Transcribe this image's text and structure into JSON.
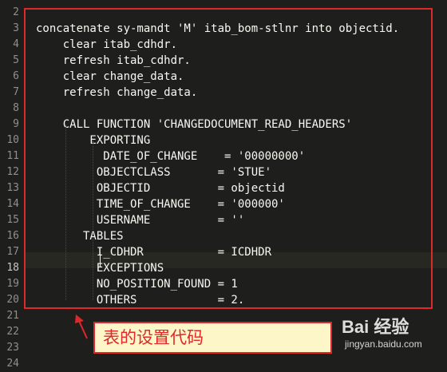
{
  "editor": {
    "line_numbers": [
      "2",
      "3",
      "4",
      "5",
      "6",
      "7",
      "8",
      "9",
      "10",
      "11",
      "12",
      "13",
      "14",
      "15",
      "16",
      "17",
      "18",
      "19",
      "20",
      "21",
      "22",
      "23",
      "24"
    ],
    "current_line": "18",
    "lines": [
      "",
      "concatenate sy-mandt 'M' itab_bom-stlnr into objectid.",
      "    clear itab_cdhdr.",
      "    refresh itab_cdhdr.",
      "    clear change_data.",
      "    refresh change_data.",
      "",
      "    CALL FUNCTION 'CHANGEDOCUMENT_READ_HEADERS'",
      "        EXPORTING",
      "          DATE_OF_CHANGE    = '00000000'",
      "         OBJECTCLASS       = 'STUE'",
      "         OBJECTID          = objectid",
      "         TIME_OF_CHANGE    = '000000'",
      "         USERNAME          = ''",
      "       TABLES",
      "         I_CDHDR           = ICDHDR",
      "         EXCEPTIONS",
      "         NO_POSITION_FOUND = 1",
      "         OTHERS            = 2.",
      "",
      "",
      "",
      ""
    ]
  },
  "annotation": {
    "label": "表的设置代码"
  },
  "watermark": {
    "logo": "Bai 经验",
    "url": "jingyan.baidu.com"
  },
  "colors": {
    "background": "#1e1f1c",
    "text": "#f8f8f2",
    "annotation_border": "#e0282b",
    "annotation_bg": "#fdf6c8"
  }
}
